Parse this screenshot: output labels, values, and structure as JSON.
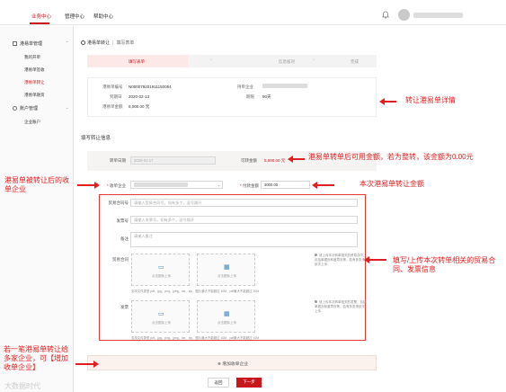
{
  "topbar": {
    "nav": [
      "业务中心",
      "管理中心",
      "帮助中心"
    ]
  },
  "sidebar": {
    "groups": [
      {
        "label": "港易单管理",
        "items": [
          "我的开单",
          "港易单签收",
          "港易单转让",
          "港易单融资"
        ]
      },
      {
        "label": "账户管理",
        "items": [
          "企业账户"
        ]
      }
    ]
  },
  "breadcrumb": {
    "title": "港易单转让",
    "sub": "填写表单"
  },
  "steps": [
    "填写表单",
    "信息核对",
    "完成"
  ],
  "details": {
    "no_label": "港易单编号",
    "no_value": "N000079201911150054",
    "holder_label": "持单企业",
    "due_label": "到期日",
    "due_value": "2020-02-13",
    "term_label": "期限",
    "term_value": "90天",
    "amount_label": "港易单金额",
    "amount_value": "8,000.00 元"
  },
  "section_title": "填写转让信息",
  "form": {
    "date_label": "转单日期",
    "date_value": "2020-01-17",
    "avail_label": "可转金额",
    "avail_value": "5,000.00 元",
    "receiver_label": "收单企业",
    "amount_label": "付款金额",
    "amount_value": "3000.00",
    "contract_no_label": "贸易合同号",
    "contract_no_placeholder": "请输入贸易合同号，如有多个，逗号隔开",
    "invoice_no_label": "发票号",
    "invoice_no_placeholder": "请输入发票号，如有多个，逗号隔开",
    "remark_label": "备注",
    "remark_placeholder": "请输入备注",
    "contract_label": "贸易合同",
    "invoice_label": "发票",
    "upload_text": "点击图标上传",
    "upload_hint": "支持文件类型 pdf、jpg、png、jpeg、rar、zip，图片最大不能超过 10M，pdf最大不能超过 10M",
    "contract_note": "请上传本次转单相关的贸易合同，包括单据页和盖章页等，若有多张请依次上传",
    "invoice_note": "请上传本次转单相关的发票，包括单据页和盖章页等，若有多张请依次上传"
  },
  "add_label": "增加收单企业",
  "buttons": {
    "back": "返回",
    "next": "下一步"
  },
  "annotations": {
    "a1": "转让港易单详情",
    "a2": "港易单转单后可用金额，若为整转，该金额为0.00元",
    "a3": "港易单被转让后的收单企业",
    "a4": "本次港易单转让金额",
    "a5": "填写/上传本次转单相关的贸易合同、发票信息",
    "a6": "若一笔港易单转让给多家企业，可【增加收单企业】"
  },
  "watermark": "大数据时代"
}
